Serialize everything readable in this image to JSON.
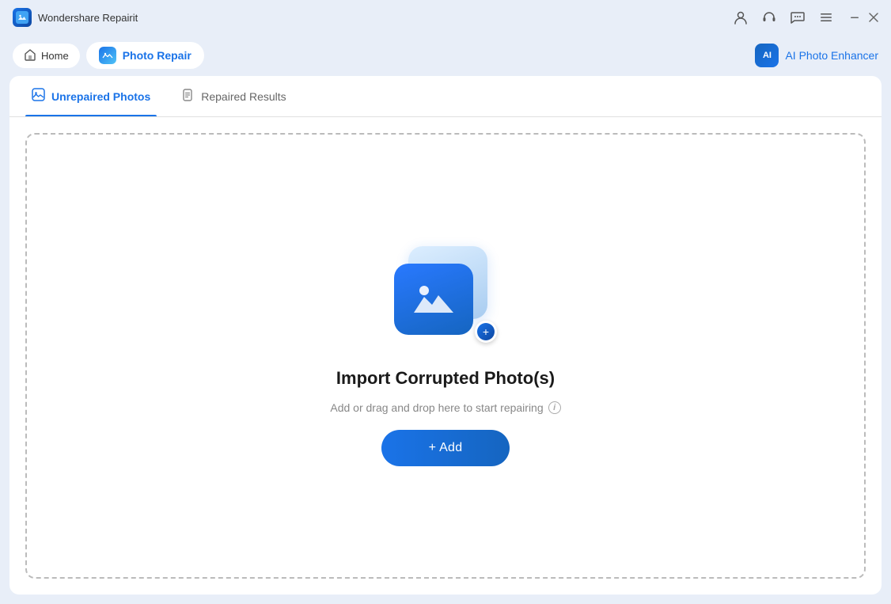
{
  "app": {
    "name": "Wondershare Repairit",
    "icon": "R"
  },
  "titlebar": {
    "icons": {
      "account": "👤",
      "headset": "🎧",
      "chat": "💬",
      "menu": "☰",
      "minimize": "—",
      "close": "✕"
    }
  },
  "navbar": {
    "home_label": "Home",
    "photo_repair_label": "Photo Repair",
    "ai_enhancer_label": "AI Photo Enhancer",
    "ai_icon_text": "AI"
  },
  "tabs": [
    {
      "id": "unrepaired",
      "label": "Unrepaired Photos",
      "active": true
    },
    {
      "id": "repaired",
      "label": "Repaired Results",
      "active": false
    }
  ],
  "dropzone": {
    "title": "Import Corrupted Photo(s)",
    "subtitle": "Add or drag and drop here to start repairing",
    "add_button": "+ Add",
    "info_tooltip": "i"
  }
}
